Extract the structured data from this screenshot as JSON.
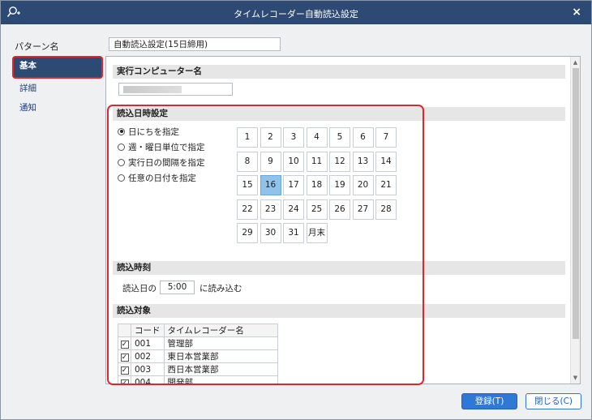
{
  "window": {
    "title": "タイムレコーダー自動読込設定",
    "app_icon": "search-plus-icon",
    "close_glyph": "×"
  },
  "pattern": {
    "label": "パターン名",
    "value": "自動読込設定(15日締用)"
  },
  "nav": {
    "items": [
      {
        "label": "基本"
      },
      {
        "label": "詳細"
      },
      {
        "label": "通知"
      }
    ]
  },
  "computer": {
    "header": "実行コンピューター名"
  },
  "read_datetime": {
    "header": "読込日時設定",
    "options": [
      {
        "label": "日にちを指定",
        "checked": true
      },
      {
        "label": "週・曜日単位で指定",
        "checked": false
      },
      {
        "label": "実行日の間隔を指定",
        "checked": false
      },
      {
        "label": "任意の日付を指定",
        "checked": false
      }
    ],
    "days": [
      "1",
      "2",
      "3",
      "4",
      "5",
      "6",
      "7",
      "8",
      "9",
      "10",
      "11",
      "12",
      "13",
      "14",
      "15",
      "16",
      "17",
      "18",
      "19",
      "20",
      "21",
      "22",
      "23",
      "24",
      "25",
      "26",
      "27",
      "28",
      "29",
      "30",
      "31",
      "月末"
    ],
    "selected_day": "16"
  },
  "read_time": {
    "header": "読込時刻",
    "prefix": "読込日の",
    "value": "5:00",
    "suffix": "に読み込む"
  },
  "read_target": {
    "header": "読込対象",
    "columns": {
      "code": "コード",
      "name": "タイムレコーダー名"
    },
    "rows": [
      {
        "checked": true,
        "code": "001",
        "name": "管理部"
      },
      {
        "checked": true,
        "code": "002",
        "name": "東日本営業部"
      },
      {
        "checked": true,
        "code": "003",
        "name": "西日本営業部"
      },
      {
        "checked": true,
        "code": "004",
        "name": "開発部"
      }
    ]
  },
  "buttons": {
    "register": "登録(T)",
    "close": "閉じる(C)"
  },
  "colors": {
    "titlebar": "#2c4a74",
    "accent": "#2f78d6",
    "highlight": "#e0262c",
    "selected_day": "#8fc3ec"
  }
}
